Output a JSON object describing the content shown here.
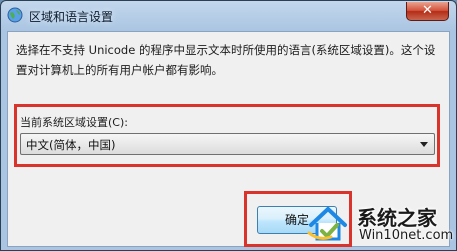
{
  "window": {
    "title": "区域和语言设置",
    "close_glyph": "✕"
  },
  "body": {
    "description": "选择在不支持 Unicode 的程序中显示文本时所使用的语言(系统区域设置)。这个设置对计算机上的所有用户帐户都有影响。",
    "current_label": "当前系统区域设置(C):",
    "current_value": "中文(简体，中国)"
  },
  "buttons": {
    "ok_label": "确定"
  },
  "watermark": {
    "brand": "系统之家",
    "url": "Win10net.com"
  },
  "colors": {
    "highlight": "#d9332b",
    "titlebar": "#aac5e2"
  }
}
